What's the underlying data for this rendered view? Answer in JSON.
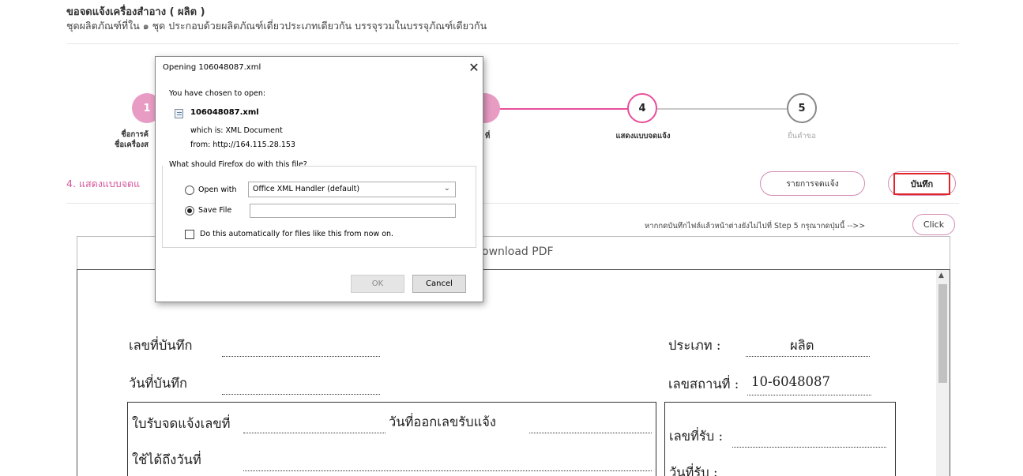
{
  "header": {
    "title": "ขอจดแจ้งเครื่องสำอาง ( ผลิต )",
    "subtitle": "ชุดผลิตภัณฑ์ที่ใน ๑ ชุด ประกอบด้วยผลิตภัณฑ์เดี่ยวประเภทเดียวกัน บรรจุรวมในบรรจุภัณฑ์เดียวกัน"
  },
  "stepper": {
    "steps": [
      {
        "number": "1",
        "label_line1": "ชื่อการค้",
        "label_line2": "ชื่อเครื่องส"
      },
      {
        "number": "",
        "label_line1": "ที่",
        "label_line2": ""
      },
      {
        "number": "4",
        "label_line1": "แสดงแบบจดแจ้ง",
        "label_line2": ""
      },
      {
        "number": "5",
        "label_line1": "ยื่นคำขอ",
        "label_line2": ""
      }
    ],
    "active_color": "#e84f9a",
    "inactive_color": "#c8c8c8"
  },
  "section": {
    "title": "4. แสดงแบบจดแ",
    "list_button": "รายการจดแจ้ง",
    "save_button": "บันทึก",
    "hint": "หากกดบันทึกไฟล์แล้วหน้าต่างยังไม่ไปที่ Step 5 กรุณากดปุ่มนี้ -->>",
    "click_button": "Click",
    "download_tab": "ownload PDF"
  },
  "document": {
    "record_no_label": "เลขที่บันทึก",
    "record_date_label": "วันที่บันทึก",
    "type_label": "ประเภท :",
    "type_value": "ผลิต",
    "place_label": "เลขสถานที่ :",
    "place_value": "10-6048087",
    "receipt_label": "ใบรับจดแจ้งเลขที่",
    "issue_date_label": "วันที่ออกเลขรับแจ้ง",
    "valid_until_label": "ใช้ได้ถึงวันที่",
    "receive_no_label": "เลขที่รับ :",
    "receive_date_label": "วันที่รับ :"
  },
  "dialog": {
    "title": "Opening 106048087.xml",
    "chosen_text": "You have chosen to open:",
    "file_name": "106048087.xml",
    "which_is": "which is: XML Document",
    "from": "from: http://164.115.28.153",
    "question": "What should Firefox do with this file?",
    "open_with_label": "Open with",
    "open_with_app": "Office XML Handler (default)",
    "save_file_label": "Save File",
    "auto_label": "Do this automatically for files like this from now on.",
    "ok_label": "OK",
    "cancel_label": "Cancel",
    "selected_option": "save_file"
  }
}
